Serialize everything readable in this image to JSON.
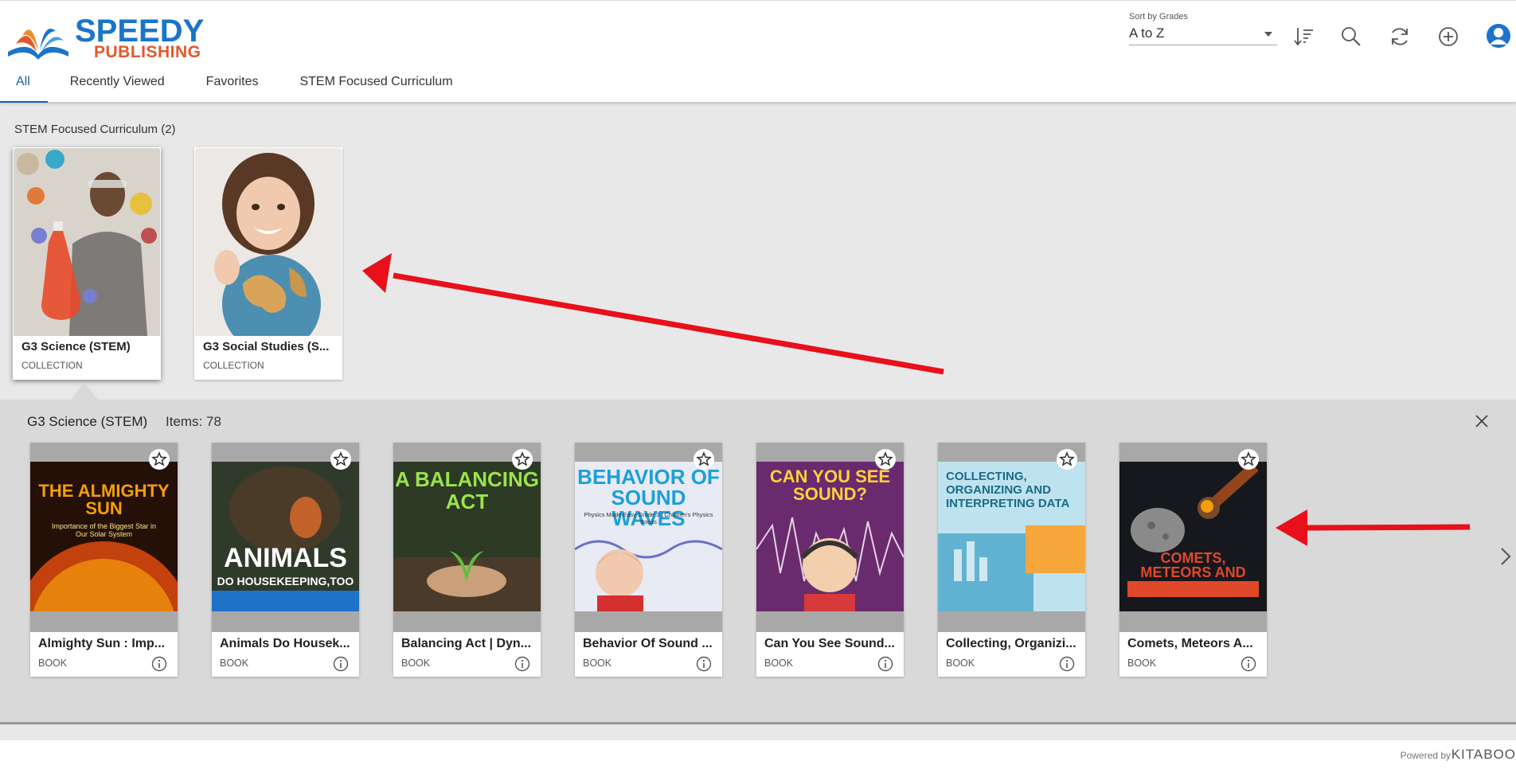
{
  "brand": {
    "line1": "SPEEDY",
    "line2": "PUBLISHING",
    "primary_color": "#1b74c9",
    "accent_color": "#e4572a"
  },
  "tabs": [
    {
      "label": "All",
      "active": true
    },
    {
      "label": "Recently Viewed",
      "active": false
    },
    {
      "label": "Favorites",
      "active": false
    },
    {
      "label": "STEM Focused Curriculum",
      "active": false
    }
  ],
  "sort": {
    "label": "Sort by Grades",
    "value": "A to Z"
  },
  "header_icons": [
    "sort-order-icon",
    "search-icon",
    "refresh-icon",
    "add-circle-icon",
    "user-avatar-icon"
  ],
  "section": {
    "title": "STEM Focused Curriculum (2)",
    "collections": [
      {
        "title": "G3 Science (STEM)",
        "type": "COLLECTION",
        "selected": true
      },
      {
        "title": "G3 Social Studies (S...",
        "type": "COLLECTION",
        "selected": false
      }
    ]
  },
  "panel": {
    "title": "G3 Science (STEM)",
    "items_label": "Items: 78",
    "books": [
      {
        "title": "Almighty Sun : Imp...",
        "type": "BOOK",
        "cover_heading": "THE ALMIGHTY SUN",
        "cover_sub": "Importance of the Biggest Star in Our Solar System"
      },
      {
        "title": "Animals Do Housek...",
        "type": "BOOK",
        "cover_heading": "ANIMALS",
        "cover_sub": "DO HOUSEKEEPING,TOO"
      },
      {
        "title": "Balancing Act | Dyn...",
        "type": "BOOK",
        "cover_heading": "A BALANCING ACT",
        "cover_sub": ""
      },
      {
        "title": "Behavior Of Sound ...",
        "type": "BOOK",
        "cover_heading": "BEHAVIOR OF SOUND WAVES",
        "cover_sub": "Physics Made Easy Grade 3 | Children's Physics Books"
      },
      {
        "title": "Can You See Sound...",
        "type": "BOOK",
        "cover_heading": "CAN YOU SEE SOUND?",
        "cover_sub": ""
      },
      {
        "title": "Collecting, Organizi...",
        "type": "BOOK",
        "cover_heading": "COLLECTING, ORGANIZING AND INTERPRETING DATA",
        "cover_sub": ""
      },
      {
        "title": "Comets, Meteors A...",
        "type": "BOOK",
        "cover_heading": "COMETS, METEORS AND ASTEROIDS",
        "cover_sub": ""
      }
    ]
  },
  "footer": {
    "powered": "Powered by",
    "brand": "KITABOO"
  },
  "annotation_color": "#e8101a"
}
